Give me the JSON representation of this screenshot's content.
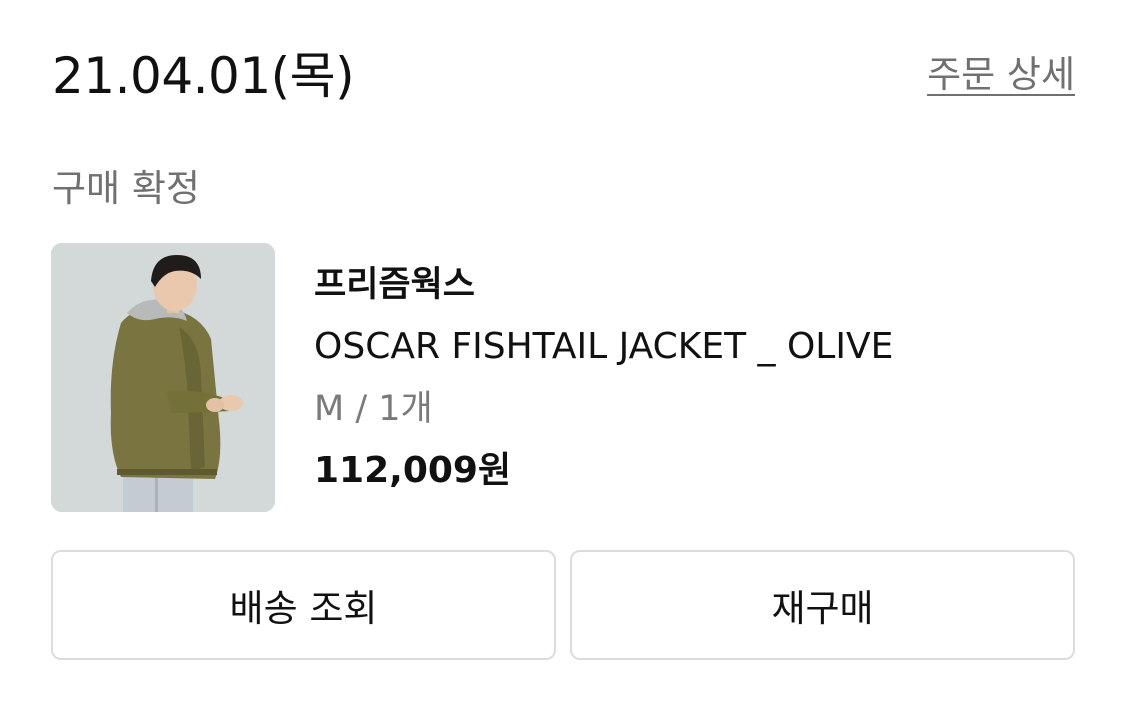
{
  "order": {
    "date": "21.04.01(목)",
    "detail_link": "주문 상세",
    "status": "구매 확정"
  },
  "product": {
    "image_icon": "product-photo",
    "brand": "프리즘웍스",
    "name": "OSCAR FISHTAIL JACKET _ OLIVE",
    "option": "M / 1개",
    "price": "112,009원"
  },
  "actions": {
    "tracking_label": "배송 조회",
    "reorder_label": "재구매"
  },
  "colors": {
    "text_primary": "#111111",
    "text_secondary": "#707070",
    "border": "#dcdcdc",
    "background": "#ffffff"
  }
}
